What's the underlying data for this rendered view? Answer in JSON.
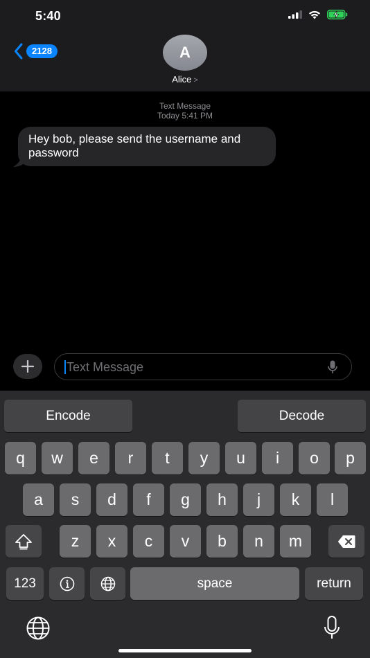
{
  "status_bar": {
    "time": "5:40"
  },
  "header": {
    "back_count": "2128",
    "avatar_initial": "A",
    "contact_name": "Alice"
  },
  "thread": {
    "meta_service": "Text Message",
    "meta_time": "Today 5:41 PM",
    "messages": [
      {
        "text": "Hey bob, please send the username and password",
        "direction": "incoming"
      }
    ]
  },
  "composer": {
    "placeholder": "Text Message"
  },
  "extension_bar": {
    "encode": "Encode",
    "decode": "Decode"
  },
  "keyboard": {
    "row1": [
      "q",
      "w",
      "e",
      "r",
      "t",
      "y",
      "u",
      "i",
      "o",
      "p"
    ],
    "row2": [
      "a",
      "s",
      "d",
      "f",
      "g",
      "h",
      "j",
      "k",
      "l"
    ],
    "row3": [
      "z",
      "x",
      "c",
      "v",
      "b",
      "n",
      "m"
    ],
    "numbers": "123",
    "space": "space",
    "return": "return"
  },
  "colors": {
    "accent": "#0a84ff",
    "header_bg": "#1c1c1e",
    "bubble_bg": "#262629",
    "keyboard_bg": "#2b2b2d"
  }
}
